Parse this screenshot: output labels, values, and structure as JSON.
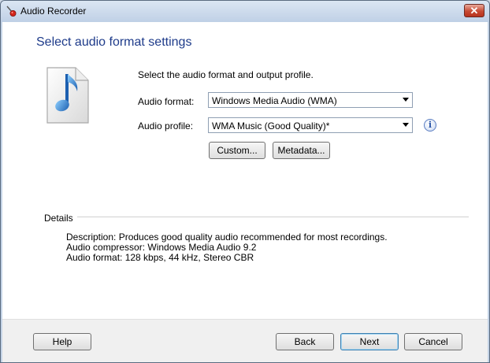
{
  "window": {
    "title": "Audio Recorder",
    "close_glyph": "✕"
  },
  "page": {
    "heading": "Select audio format settings",
    "intro": "Select the audio format and output profile.",
    "icon": "audio-file-music-icon"
  },
  "format": {
    "label": "Audio format:",
    "value": "Windows Media Audio (WMA)"
  },
  "profile": {
    "label": "Audio profile:",
    "value": "WMA Music (Good Quality)*"
  },
  "buttons": {
    "custom": "Custom...",
    "metadata": "Metadata...",
    "help": "Help",
    "back": "Back",
    "next": "Next",
    "cancel": "Cancel"
  },
  "details": {
    "label": "Details",
    "lines": [
      "Description:  Produces good quality audio recommended for most recordings.",
      "Audio compressor:  Windows Media Audio 9.2",
      "Audio format:  128 kbps, 44 kHz, Stereo CBR"
    ]
  },
  "colors": {
    "heading": "#1e3b8a",
    "close_button": "#c74a33",
    "note": "#2d7fd3"
  }
}
